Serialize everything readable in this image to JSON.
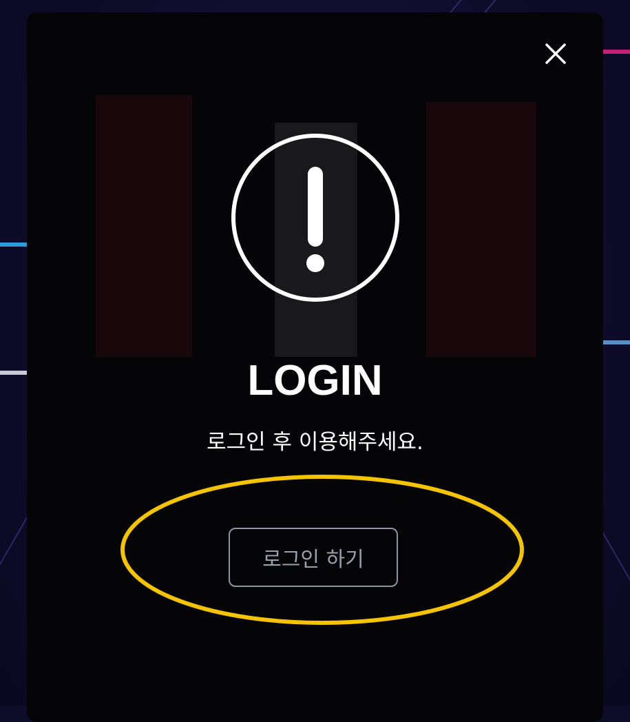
{
  "modal": {
    "title": "LOGIN",
    "message": "로그인 후 이용해주세요.",
    "login_button_label": "로그인 하기",
    "close_icon": "close-icon",
    "alert_icon": "exclamation-circle-icon"
  },
  "colors": {
    "modal_background": "#050507",
    "text": "#ffffff",
    "button_border": "#8e96a6",
    "button_text": "#9aa1ae",
    "highlight": "#f5c400",
    "backdrop": "#0f0c2a"
  }
}
